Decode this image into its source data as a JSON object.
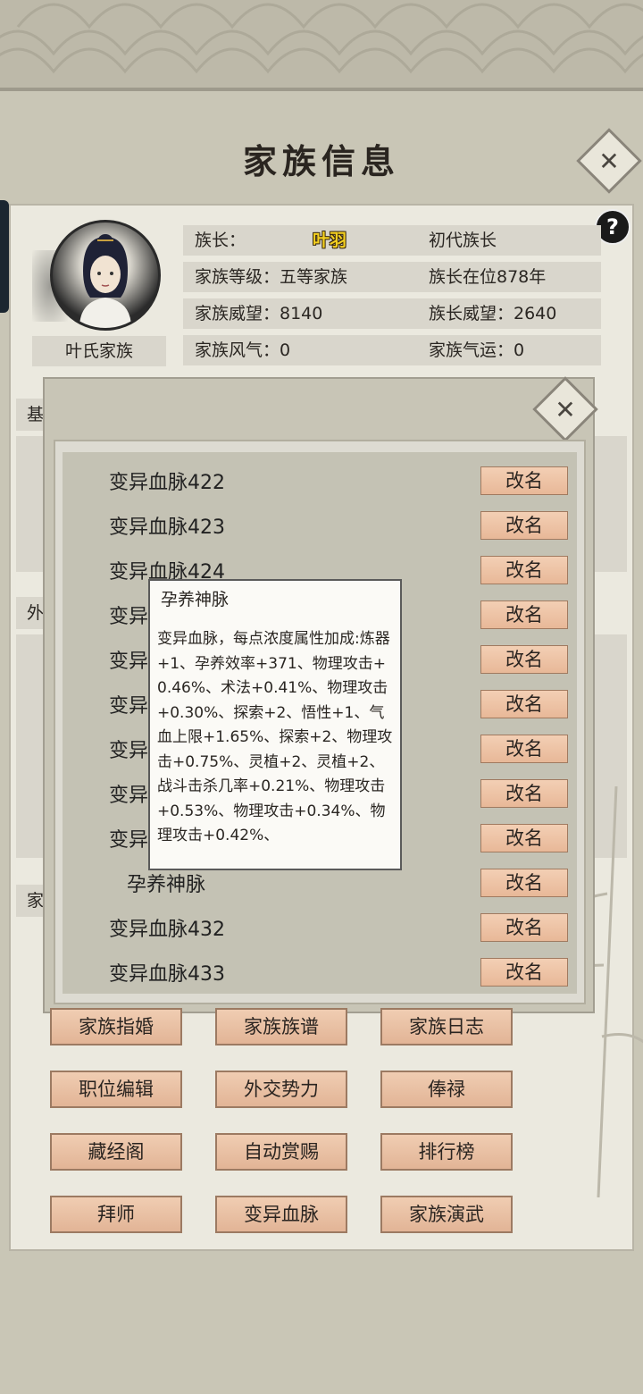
{
  "header": {
    "title": "家族信息"
  },
  "icons": {
    "close": "close-icon",
    "help": "help-icon",
    "help_glyph": "?",
    "close_glyph": "✕"
  },
  "profile": {
    "family_name": "叶氏家族",
    "rows": [
      {
        "left": "族长：",
        "center": "叶羽",
        "right": "初代族长"
      },
      {
        "left": "家族等级：五等家族",
        "right": "族长在位878年"
      },
      {
        "left": "家族威望：8140",
        "right": "族长威望：2640"
      },
      {
        "left": "家族风气：0",
        "right": "家族气运：0"
      }
    ]
  },
  "sections": {
    "basic_tab": "基",
    "external_tab": "外",
    "family_tab": "家"
  },
  "bloodline_list": {
    "rename_label": "改名",
    "items": [
      "变异血脉422",
      "变异血脉423",
      "变异血脉424",
      "变异",
      "变异",
      "变异",
      "变异",
      "变异",
      "变异",
      "孕养神脉",
      "变异血脉432",
      "变异血脉433"
    ]
  },
  "tooltip": {
    "title": "孕养神脉",
    "body": "变异血脉，每点浓度属性加成:炼器+1、孕养效率+371、物理攻击+0.46%、术法+0.41%、物理攻击+0.30%、探索+2、悟性+1、气血上限+1.65%、探索+2、物理攻击+0.75%、灵植+2、灵植+2、战斗击杀几率+0.21%、物理攻击+0.53%、物理攻击+0.34%、物理攻击+0.42%、"
  },
  "actions": [
    "家族指婚",
    "家族族谱",
    "家族日志",
    "职位编辑",
    "外交势力",
    "俸禄",
    "藏经阁",
    "自动赏赐",
    "排行榜",
    "拜师",
    "变异血脉",
    "家族演武"
  ],
  "colors": {
    "background": "#c9c6b6",
    "panel": "#ebe9df",
    "button": "#e8b898",
    "leader_name": "#f4d020"
  }
}
